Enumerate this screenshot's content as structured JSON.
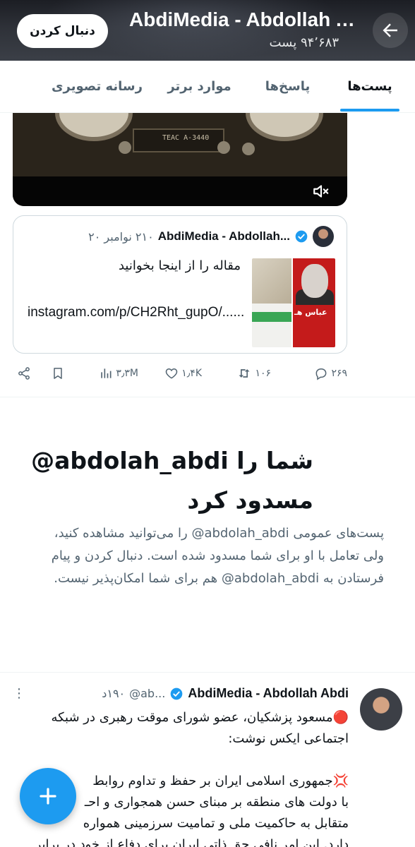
{
  "header": {
    "title": "AbdiMedia - Abdollah Abdi",
    "post_count": "۹۴٬۶۸۳ پست",
    "follow_label": "دنبال کردن"
  },
  "tabs": [
    {
      "label": "پست‌ها",
      "active": true
    },
    {
      "label": "پاسخ‌ها",
      "active": false
    },
    {
      "label": "موارد برتر",
      "active": false
    },
    {
      "label": "رسانه تصویری",
      "active": false
    }
  ],
  "video": {
    "deck_label": "TEAC A-3440",
    "icon": "volume-mute-icon"
  },
  "quoted_post": {
    "name": "AbdiMedia - Abdollah...",
    "date": "۲۱۰ نوامبر ۲۰",
    "text": "مقاله را از اینجا بخوانید",
    "link": "instagram.com/p/CH2Rht_gupO/......",
    "thumbnail_text": "عباس هـ"
  },
  "actions": {
    "replies": "۲۶۹",
    "reposts": "۱۰۶",
    "likes": "۱٫۴K",
    "views": "۳٫۳M"
  },
  "blocked": {
    "title": "شما را ‎@abdolah_abdi‎ مسدود کرد",
    "body": "پست‌های عمومی ‎@abdolah_abdi‎ را می‌توانید مشاهده کنید، ولی تعامل با او برای شما مسدود شده است. دنبال کردن و پیام فرستادن به ‎@abdolah_abdi‎ هم برای شما امکان‌پذیر نیست."
  },
  "tweet": {
    "name": "AbdiMedia - Abdollah Abdi",
    "handle": "@ab...",
    "time": "۱۹۰د",
    "line1": "🔴مسعود پزشکیان، عضو شورای موقت رهبری در شبکه اجتماعی ایکس نوشت:",
    "line2": "💢جمهوری اسلامی ایران بر حفظ و تداوم روابط",
    "line3": "با دولت های منطقه بر مبنای حسن همجواری و احـ",
    "line4": "متقابل به حاکمیت ملی و تمامیت سرزمینی همواره",
    "line5": "دارد. این امر نافی حق ذاتی ایران برای دفاع از خود در برابر"
  },
  "colors": {
    "accent": "#1d9bf0",
    "text_primary": "#0f1419",
    "text_secondary": "#536471",
    "border": "#cfd9de"
  }
}
